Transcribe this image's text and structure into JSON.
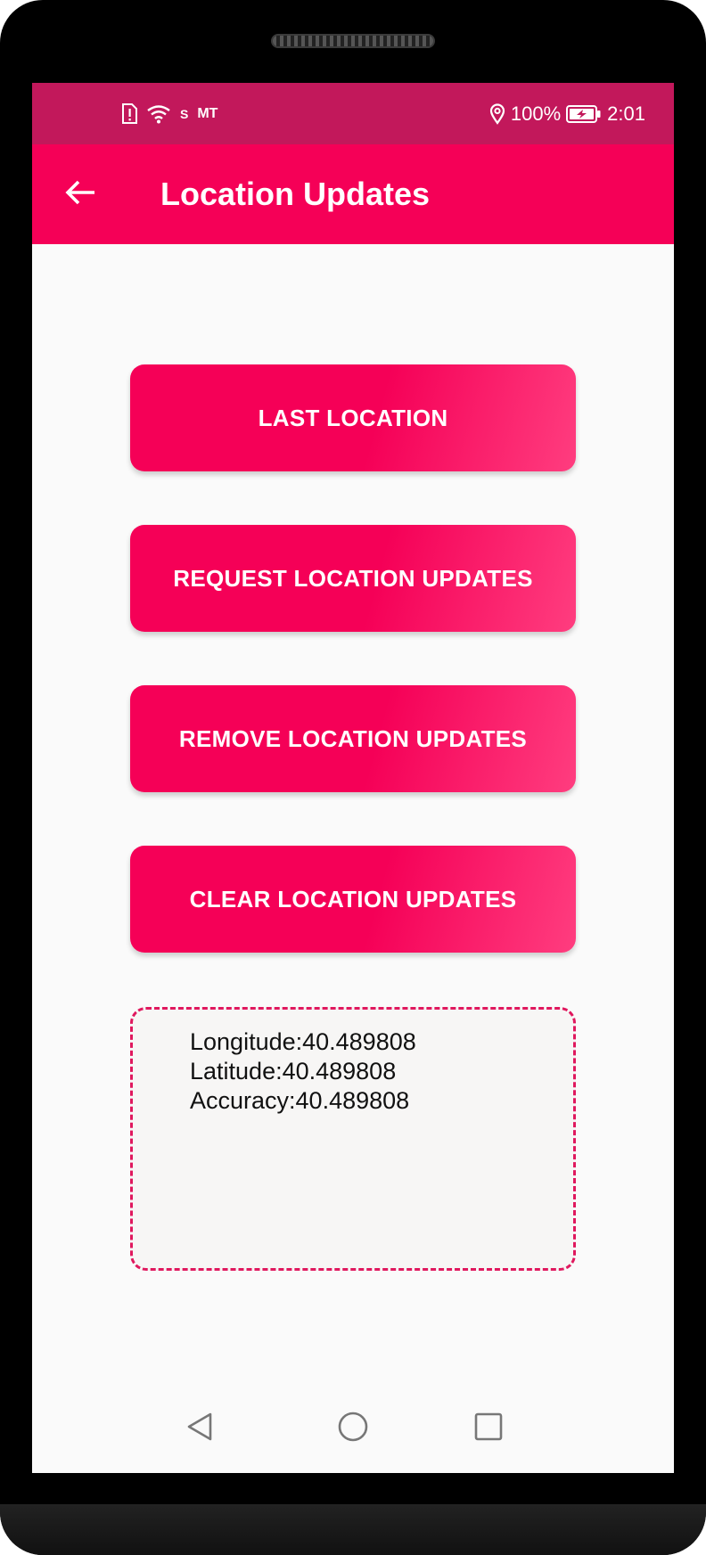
{
  "statusbar": {
    "left_icons": [
      "sim-alert-icon",
      "wifi-icon"
    ],
    "small_label": "S",
    "carrier": "MT",
    "location_icon": "location-pin-icon",
    "battery_percent": "100%",
    "battery_icon": "battery-charging-icon",
    "time": "2:01"
  },
  "appbar": {
    "back_icon": "arrow-left-icon",
    "title": "Location Updates"
  },
  "buttons": [
    {
      "label": "LAST LOCATION"
    },
    {
      "label": "REQUEST LOCATION UPDATES"
    },
    {
      "label": "REMOVE LOCATION UPDATES"
    },
    {
      "label": "CLEAR LOCATION UPDATES"
    }
  ],
  "info": {
    "lines": [
      "Longitude:40.489808",
      "Latitude:40.489808",
      "Accuracy:40.489808"
    ]
  },
  "navbar": {
    "back_icon": "triangle-back-icon",
    "home_icon": "circle-home-icon",
    "recents_icon": "square-recents-icon"
  },
  "colors": {
    "statusbar": "#c2185b",
    "appbar": "#f50057",
    "button_start": "#f50057",
    "button_end": "#ff3d7f",
    "dashed_border": "#e0185e"
  }
}
